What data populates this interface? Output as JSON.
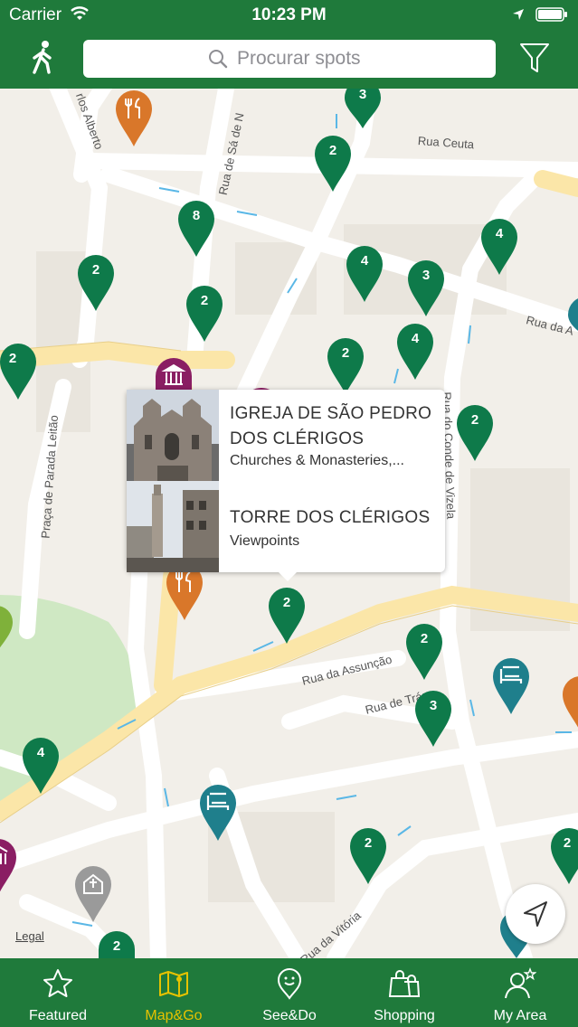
{
  "status_bar": {
    "carrier": "Carrier",
    "time": "10:23 PM"
  },
  "header": {
    "search_placeholder": "Procurar spots"
  },
  "map": {
    "street_labels": [
      "Rua Ceuta",
      "Rua da A",
      "Rua do Conde de Vizela",
      "Praça de Parada Leitão",
      "Rua da Assunção",
      "Rua de Trás",
      "Rua da Vitória",
      "Rua de Sá de N",
      "rlos Alberto"
    ],
    "legal": "Legal",
    "pin_counts": [
      "3",
      "2",
      "8",
      "2",
      "2",
      "4",
      "4",
      "3",
      "2",
      "4",
      "2",
      "2",
      "2",
      "2",
      "3",
      "4",
      "2",
      "2",
      "2"
    ]
  },
  "popup": {
    "items": [
      {
        "title_line1": "IGREJA DE SÃO PEDRO",
        "title_line2": "DOS CLÉRIGOS",
        "category": "Churches & Monasteries,..."
      },
      {
        "title_line1": "TORRE DOS CLÉRIGOS",
        "category": "Viewpoints"
      }
    ]
  },
  "tabs": [
    {
      "label": "Featured",
      "icon": "star-icon"
    },
    {
      "label": "Map&Go",
      "icon": "map-icon",
      "active": true
    },
    {
      "label": "See&Do",
      "icon": "smiley-pin-icon"
    },
    {
      "label": "Shopping",
      "icon": "shopping-bags-icon"
    },
    {
      "label": "My Area",
      "icon": "user-star-icon"
    }
  ],
  "colors": {
    "brand_green": "#1f7a3b",
    "pin_green": "#0e7a4a",
    "active_tab": "#e6c200",
    "pin_orange": "#d9772a",
    "pin_teal": "#1f7f8c",
    "pin_purple": "#8a1e63",
    "pin_gray": "#9a9a9a"
  }
}
